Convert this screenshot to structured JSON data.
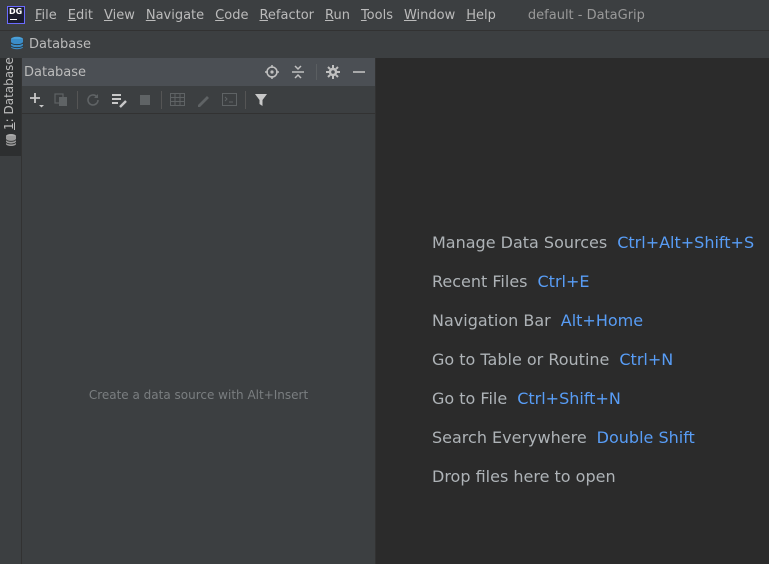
{
  "app": {
    "logo_text": "DG",
    "window_title": "default - DataGrip"
  },
  "menu": [
    {
      "label": "File",
      "mnemonic": "F",
      "rest": "ile"
    },
    {
      "label": "Edit",
      "mnemonic": "E",
      "rest": "dit"
    },
    {
      "label": "View",
      "mnemonic": "V",
      "rest": "iew"
    },
    {
      "label": "Navigate",
      "mnemonic": "N",
      "rest": "avigate"
    },
    {
      "label": "Code",
      "mnemonic": "C",
      "rest": "ode"
    },
    {
      "label": "Refactor",
      "mnemonic": "R",
      "rest": "efactor"
    },
    {
      "label": "Run",
      "mnemonic": "R",
      "rest": "un"
    },
    {
      "label": "Tools",
      "mnemonic": "T",
      "rest": "ools"
    },
    {
      "label": "Window",
      "mnemonic": "W",
      "rest": "indow"
    },
    {
      "label": "Help",
      "mnemonic": "H",
      "rest": "elp"
    }
  ],
  "navbar": {
    "label": "Database"
  },
  "side_strip": {
    "tab_number": "1",
    "tab_label": ": Database"
  },
  "panel": {
    "title": "Database",
    "empty_text": "Create a data source with Alt+Insert",
    "header_icons": [
      "target-icon",
      "collapse-all-icon",
      "gear-icon",
      "minimize-icon"
    ],
    "toolbar_icons": [
      "add-icon",
      "duplicate-icon",
      "refresh-icon",
      "schema-settings-icon",
      "stop-icon",
      "table-view-icon",
      "edit-icon",
      "console-icon",
      "filter-icon"
    ]
  },
  "hints": [
    {
      "text": "Manage Data Sources",
      "key": "Ctrl+Alt+Shift+S"
    },
    {
      "text": "Recent Files",
      "key": "Ctrl+E"
    },
    {
      "text": "Navigation Bar",
      "key": "Alt+Home"
    },
    {
      "text": "Go to Table or Routine",
      "key": "Ctrl+N"
    },
    {
      "text": "Go to File",
      "key": "Ctrl+Shift+N"
    },
    {
      "text": "Search Everywhere",
      "key": "Double Shift"
    },
    {
      "text": "Drop files here to open",
      "key": ""
    }
  ],
  "colors": {
    "background": "#2b2b2b",
    "panel": "#3c3f41",
    "header": "#4b4f54",
    "shortcut": "#589df6",
    "text": "#bbbbbb"
  }
}
